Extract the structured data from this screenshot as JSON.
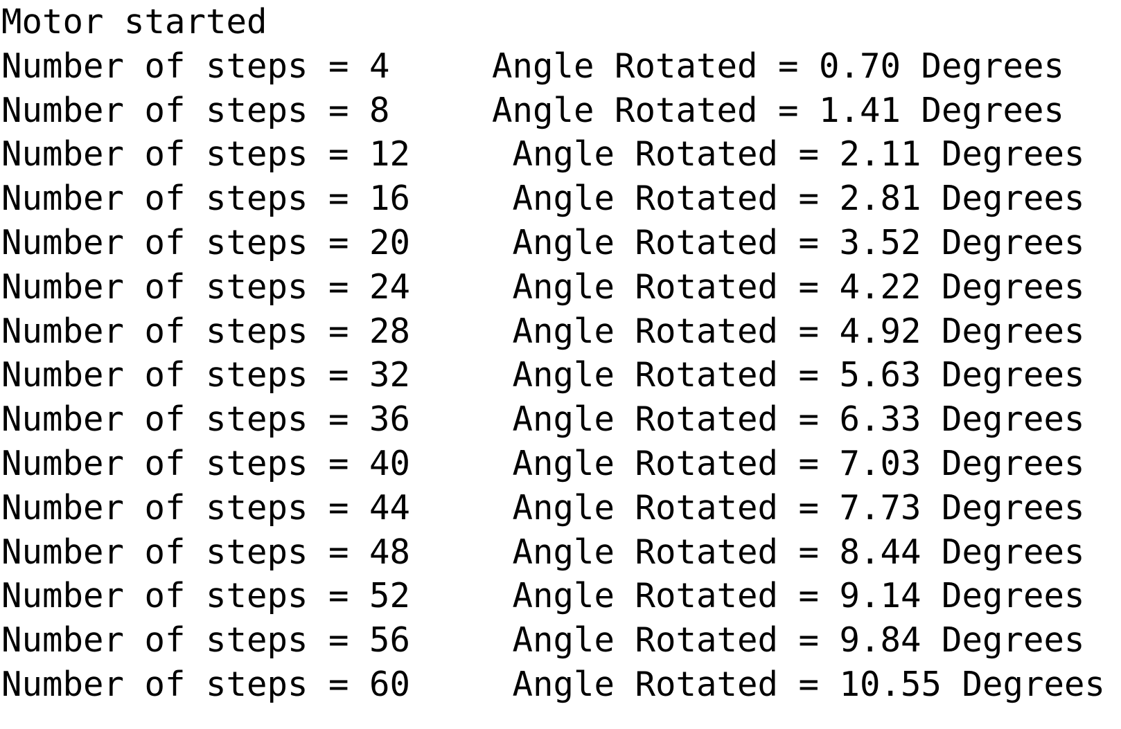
{
  "console": {
    "status_message": "Motor started",
    "step_label": "Number of steps = ",
    "angle_label": "Angle Rotated = ",
    "angle_unit": " Degrees",
    "column_gap_1digit": "    ",
    "column_gap_2digit": "    ",
    "background_color": "#ffffff",
    "text_color": "#000000",
    "rows": [
      {
        "steps": "4",
        "angle": "0.70",
        "line": "Number of steps = 4     Angle Rotated = 0.70 Degrees"
      },
      {
        "steps": "8",
        "angle": "1.41",
        "line": "Number of steps = 8     Angle Rotated = 1.41 Degrees"
      },
      {
        "steps": "12",
        "angle": "2.11",
        "line": "Number of steps = 12     Angle Rotated = 2.11 Degrees"
      },
      {
        "steps": "16",
        "angle": "2.81",
        "line": "Number of steps = 16     Angle Rotated = 2.81 Degrees"
      },
      {
        "steps": "20",
        "angle": "3.52",
        "line": "Number of steps = 20     Angle Rotated = 3.52 Degrees"
      },
      {
        "steps": "24",
        "angle": "4.22",
        "line": "Number of steps = 24     Angle Rotated = 4.22 Degrees"
      },
      {
        "steps": "28",
        "angle": "4.92",
        "line": "Number of steps = 28     Angle Rotated = 4.92 Degrees"
      },
      {
        "steps": "32",
        "angle": "5.63",
        "line": "Number of steps = 32     Angle Rotated = 5.63 Degrees"
      },
      {
        "steps": "36",
        "angle": "6.33",
        "line": "Number of steps = 36     Angle Rotated = 6.33 Degrees"
      },
      {
        "steps": "40",
        "angle": "7.03",
        "line": "Number of steps = 40     Angle Rotated = 7.03 Degrees"
      },
      {
        "steps": "44",
        "angle": "7.73",
        "line": "Number of steps = 44     Angle Rotated = 7.73 Degrees"
      },
      {
        "steps": "48",
        "angle": "8.44",
        "line": "Number of steps = 48     Angle Rotated = 8.44 Degrees"
      },
      {
        "steps": "52",
        "angle": "9.14",
        "line": "Number of steps = 52     Angle Rotated = 9.14 Degrees"
      },
      {
        "steps": "56",
        "angle": "9.84",
        "line": "Number of steps = 56     Angle Rotated = 9.84 Degrees"
      },
      {
        "steps": "60",
        "angle": "10.55",
        "line": "Number of steps = 60     Angle Rotated = 10.55 Degrees"
      }
    ]
  }
}
